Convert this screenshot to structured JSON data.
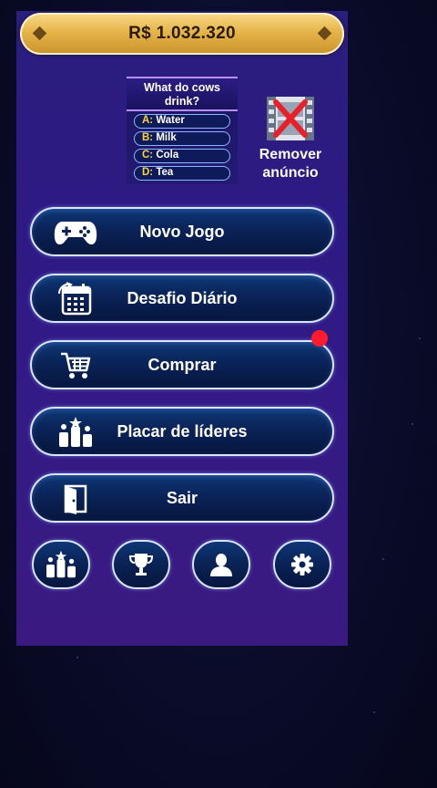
{
  "balance": "R$ 1.032.320",
  "quiz_logo": {
    "question": "What do cows drink?",
    "options": [
      {
        "letter": "A:",
        "text": "Water"
      },
      {
        "letter": "B:",
        "text": "Milk"
      },
      {
        "letter": "C:",
        "text": "Cola"
      },
      {
        "letter": "D:",
        "text": "Tea"
      }
    ]
  },
  "remove_ad": {
    "line1": "Remover",
    "line2": "anúncio"
  },
  "menu": [
    {
      "label": "Novo Jogo",
      "icon": "gamepad-icon"
    },
    {
      "label": "Desafio Diário",
      "icon": "calendar-icon"
    },
    {
      "label": "Comprar",
      "icon": "cart-icon"
    },
    {
      "label": "Placar de líderes",
      "icon": "podium-icon"
    },
    {
      "label": "Sair",
      "icon": "exit-door-icon"
    }
  ],
  "bottom_buttons": [
    {
      "icon": "podium-icon"
    },
    {
      "icon": "trophy-icon"
    },
    {
      "icon": "profile-icon"
    },
    {
      "icon": "gear-icon"
    }
  ],
  "colors": {
    "gold": "#e6b54a",
    "panel": "#2e1a84",
    "button_fill": "#0a2358",
    "notification": "#ff1a2e",
    "option_letter": "#ffd23a"
  }
}
